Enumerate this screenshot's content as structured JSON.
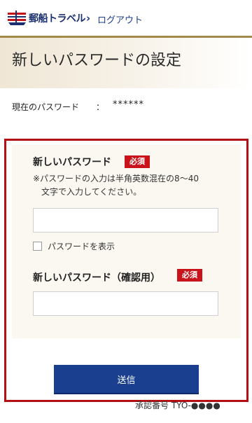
{
  "header": {
    "logo_text": "郵船トラベル",
    "logo_chevron": "›",
    "logout_label": "ログアウト"
  },
  "page": {
    "title": "新しいパスワードの設定"
  },
  "current_password": {
    "label": "現在のパスワード",
    "separator": "：",
    "value": "******"
  },
  "form": {
    "new_password": {
      "label": "新しいパスワード",
      "required_badge": "必須",
      "note_line1": "※パスワードの入力は半角英数混在の8〜40",
      "note_line2": "文字で入力してください。",
      "value": "",
      "placeholder": ""
    },
    "show_password": {
      "label": "パスワードを表示",
      "checked": false
    },
    "confirm_password": {
      "label": "新しいパスワード（確認用）",
      "required_badge": "必須",
      "value": "",
      "placeholder": ""
    },
    "submit_label": "送信"
  },
  "footer": {
    "approval_text": "承認番号 TYO-●●●●"
  },
  "colors": {
    "brand_navy": "#1a3f8f",
    "required_red": "#c8131b",
    "frame_red": "#b50f16",
    "gold_rule": "#a48a4a"
  }
}
